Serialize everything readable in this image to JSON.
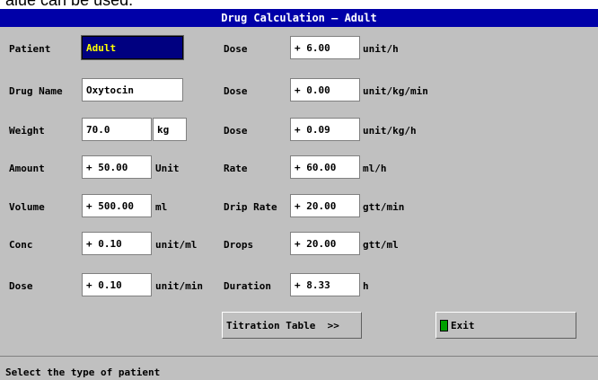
{
  "caption_fragment": "alue can be used.",
  "window": {
    "title": "Drug Calculation – Adult"
  },
  "left_fields": [
    {
      "label": "Patient",
      "value": "Adult",
      "unit": ""
    },
    {
      "label": "Drug Name",
      "value": "Oxytocin",
      "unit": ""
    },
    {
      "label": "Weight",
      "value": "70.0",
      "unit": "kg"
    },
    {
      "label": "Amount",
      "value": "+ 50.00",
      "unit": "Unit"
    },
    {
      "label": "Volume",
      "value": "+ 500.00",
      "unit": "ml"
    },
    {
      "label": "Conc",
      "value": "+ 0.10",
      "unit": "unit/ml"
    },
    {
      "label": "Dose",
      "value": "+ 0.10",
      "unit": "unit/min"
    }
  ],
  "right_fields": [
    {
      "label": "Dose",
      "value": "+ 6.00",
      "unit": "unit/h"
    },
    {
      "label": "Dose",
      "value": "+ 0.00",
      "unit": "unit/kg/min"
    },
    {
      "label": "Dose",
      "value": "+ 0.09",
      "unit": "unit/kg/h"
    },
    {
      "label": "Rate",
      "value": "+ 60.00",
      "unit": "ml/h"
    },
    {
      "label": "Drip Rate",
      "value": "+ 20.00",
      "unit": "gtt/min"
    },
    {
      "label": "Drops",
      "value": "+ 20.00",
      "unit": "gtt/ml"
    },
    {
      "label": "Duration",
      "value": "+ 8.33",
      "unit": "h"
    }
  ],
  "buttons": {
    "titration": "Titration Table  >>",
    "exit": "Exit"
  },
  "status": "Select the type of patient",
  "colors": {
    "panel": "#c0c0c0",
    "titlebar": "#0000a8",
    "selected_bg": "#000080",
    "selected_text": "#ffff00",
    "exit_icon": "#00a000"
  }
}
